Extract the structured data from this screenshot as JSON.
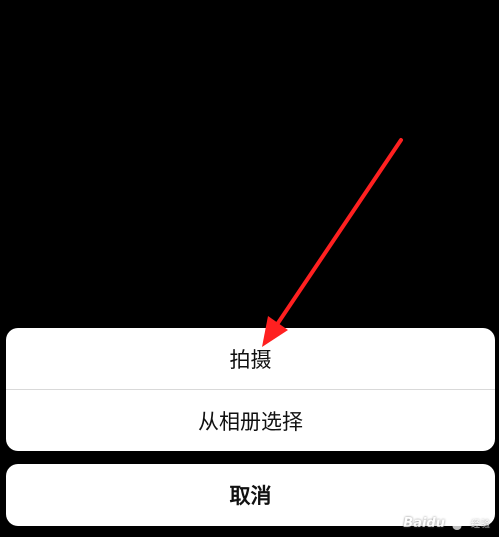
{
  "action_sheet": {
    "options": [
      {
        "label": "拍摄"
      },
      {
        "label": "从相册选择"
      }
    ],
    "cancel_label": "取消"
  },
  "annotation": {
    "arrow_color": "#ff2020"
  },
  "watermark": {
    "brand": "Baidu",
    "suffix": "经验",
    "icon": "paw-icon"
  },
  "colors": {
    "backdrop": "#000000",
    "sheet_background": "#ffffff",
    "divider": "#d9d9d9",
    "text": "#111111"
  }
}
